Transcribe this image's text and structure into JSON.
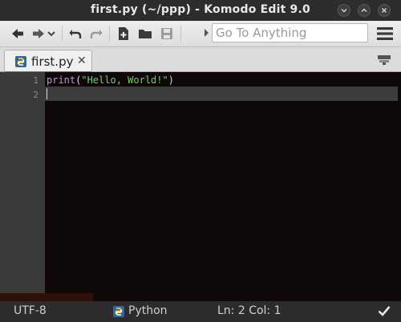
{
  "window": {
    "title": "first.py (~/ppp) - Komodo Edit 9.0"
  },
  "toolbar": {
    "goto_placeholder": "Go To Anything",
    "icons": [
      "back-arrow-icon",
      "forward-arrow-icon",
      "history-dropdown-icon",
      "undo-icon",
      "redo-icon",
      "new-file-icon",
      "open-folder-icon",
      "save-icon",
      "menu-icon"
    ]
  },
  "tabs": [
    {
      "label": "first.py",
      "close": "✕",
      "active": true
    }
  ],
  "editor": {
    "lines": [
      {
        "number": "1",
        "fn": "print",
        "open": "(",
        "str": "\"Hello, World!\"",
        "close": ")"
      },
      {
        "number": "2"
      }
    ]
  },
  "statusbar": {
    "encoding": "UTF-8",
    "language": "Python",
    "position": "Ln: 2 Col: 1"
  },
  "colors": {
    "editor_bg": "#0f0808",
    "gutter_bg": "#3a3a3a",
    "function": "#c08ee8",
    "string": "#6fcf6f",
    "tab_accent": "#3d7bd6"
  }
}
